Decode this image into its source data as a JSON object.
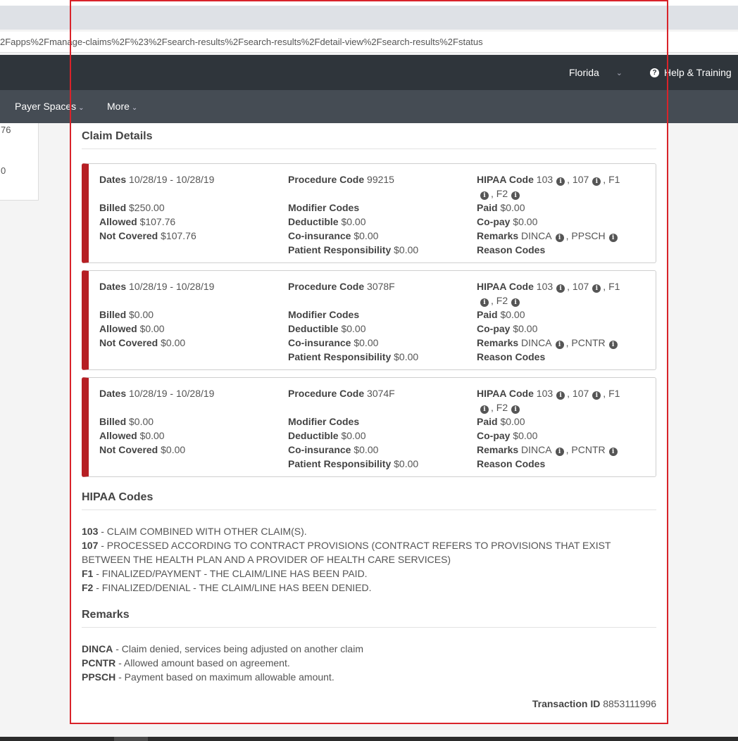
{
  "browser": {
    "url": "2Fapps%2Fmanage-claims%2F%23%2Fsearch-results%2Fsearch-results%2Fdetail-view%2Fsearch-results%2Fstatus"
  },
  "header": {
    "state": "Florida",
    "help_label": "Help & Training"
  },
  "nav": {
    "payer_spaces": "Payer Spaces",
    "more": "More"
  },
  "left_card": {
    "text1": "76",
    "text2": "0"
  },
  "claim_details": {
    "title": "Claim Details",
    "labels": {
      "dates": "Dates",
      "billed": "Billed",
      "allowed": "Allowed",
      "not_covered": "Not Covered",
      "procedure_code": "Procedure Code",
      "modifier_codes": "Modifier Codes",
      "deductible": "Deductible",
      "coinsurance": "Co-insurance",
      "patient_responsibility": "Patient Responsibility",
      "hipaa_code": "HIPAA Code",
      "paid": "Paid",
      "copay": "Co-pay",
      "remarks": "Remarks",
      "reason_codes": "Reason Codes"
    },
    "lines": [
      {
        "dates": "10/28/19 - 10/28/19",
        "billed": "$250.00",
        "allowed": "$107.76",
        "not_covered": "$107.76",
        "procedure_code": "99215",
        "deductible": "$0.00",
        "coinsurance": "$0.00",
        "patient_responsibility": "$0.00",
        "hipaa": [
          "103",
          "107",
          "F1",
          "F2"
        ],
        "paid": "$0.00",
        "copay": "$0.00",
        "remarks": [
          "DINCA",
          "PPSCH"
        ]
      },
      {
        "dates": "10/28/19 - 10/28/19",
        "billed": "$0.00",
        "allowed": "$0.00",
        "not_covered": "$0.00",
        "procedure_code": "3078F",
        "deductible": "$0.00",
        "coinsurance": "$0.00",
        "patient_responsibility": "$0.00",
        "hipaa": [
          "103",
          "107",
          "F1",
          "F2"
        ],
        "paid": "$0.00",
        "copay": "$0.00",
        "remarks": [
          "DINCA",
          "PCNTR"
        ]
      },
      {
        "dates": "10/28/19 - 10/28/19",
        "billed": "$0.00",
        "allowed": "$0.00",
        "not_covered": "$0.00",
        "procedure_code": "3074F",
        "deductible": "$0.00",
        "coinsurance": "$0.00",
        "patient_responsibility": "$0.00",
        "hipaa": [
          "103",
          "107",
          "F1",
          "F2"
        ],
        "paid": "$0.00",
        "copay": "$0.00",
        "remarks": [
          "DINCA",
          "PCNTR"
        ]
      }
    ]
  },
  "hipaa_codes": {
    "title": "HIPAA Codes",
    "items": [
      {
        "code": "103",
        "desc": " - CLAIM COMBINED WITH OTHER CLAIM(S)."
      },
      {
        "code": "107",
        "desc": " - PROCESSED ACCORDING TO CONTRACT PROVISIONS (CONTRACT REFERS TO PROVISIONS THAT EXIST BETWEEN THE HEALTH PLAN AND A PROVIDER OF HEALTH CARE SERVICES)"
      },
      {
        "code": "F1",
        "desc": " - FINALIZED/PAYMENT - THE CLAIM/LINE HAS BEEN PAID."
      },
      {
        "code": "F2",
        "desc": " - FINALIZED/DENIAL - THE CLAIM/LINE HAS BEEN DENIED."
      }
    ]
  },
  "remarks": {
    "title": "Remarks",
    "items": [
      {
        "code": "DINCA",
        "desc": " - Claim denied, services being adjusted on another claim"
      },
      {
        "code": "PCNTR",
        "desc": " - Allowed amount based on agreement."
      },
      {
        "code": "PPSCH",
        "desc": " - Payment based on maximum allowable amount."
      }
    ]
  },
  "transaction": {
    "label": "Transaction ID",
    "value": "8853111996"
  },
  "colors": {
    "accent_red": "#b61f24",
    "highlight_border": "#d9232a",
    "header_bg": "#2f353b",
    "nav_bg": "#454c54"
  }
}
